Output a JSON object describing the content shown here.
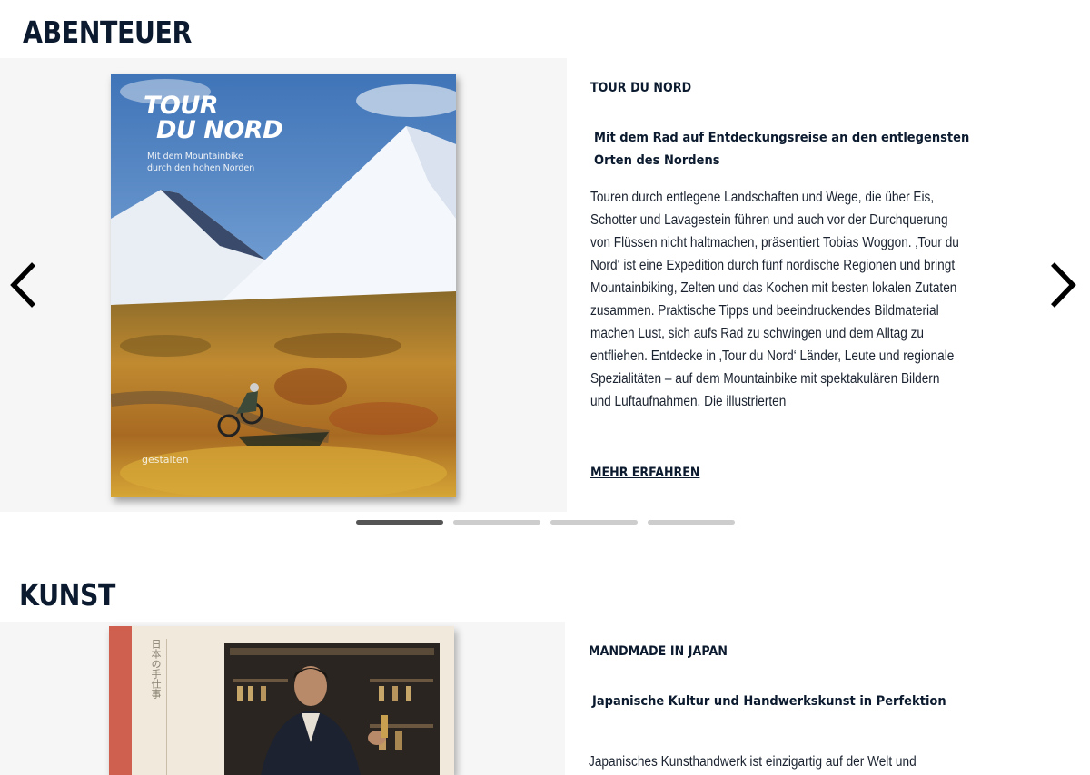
{
  "sections": [
    {
      "title": "ABENTEUER",
      "book": {
        "name": "TOUR DU NORD",
        "subtitle": "Mit dem Rad auf Entdeckungsreise an den entlegensten Orten des Nordens",
        "description": "Touren durch entlegene Landschaften und Wege, die über Eis, Schotter und Lavagestein führen und auch vor der Durchquerung von Flüssen nicht haltmachen, präsentiert Tobias Woggon. ‚Tour du Nord‘ ist eine Expedition durch fünf nordische Regionen und bringt Mountainbiking, Zelten und das Kochen mit besten lokalen Zutaten zusammen. Praktische Tipps und beeindruckendes Bildmaterial machen Lust, sich aufs Rad zu schwingen und dem Alltag zu entfliehen. Entdecke in ‚Tour du Nord‘ Länder, Leute und regionale Spezialitäten – auf dem Mountainbike mit spektakulären Bildern und Luftaufnahmen. Die illustrierten",
        "more_label": "MEHR ERFAHREN",
        "cover": {
          "title_line1": "TOUR",
          "title_line2": "DU NORD",
          "subtitle_line1": "Mit dem Mountainbike",
          "subtitle_line2": "durch den hohen Norden",
          "publisher": "gestalten"
        }
      },
      "carousel": {
        "slide_count": 4,
        "active_index": 0
      }
    },
    {
      "title": "KUNST",
      "book": {
        "name": "MANDMADE IN JAPAN",
        "subtitle": "Japanische Kultur und Handwerkskunst in Perfektion",
        "description": "Japanisches Kunsthandwerk ist einzigartig auf der Welt und",
        "cover": {
          "vertical_text": "日本の手仕事"
        }
      }
    }
  ],
  "icons": {
    "prev": "chevron-left-icon",
    "next": "chevron-right-icon"
  },
  "colors": {
    "heading": "#0b1a2e",
    "panel": "#f6f6f6",
    "dot_active": "#555555",
    "dot_inactive": "#cdcdcd",
    "cover_stripe": "#cf5f4f"
  }
}
